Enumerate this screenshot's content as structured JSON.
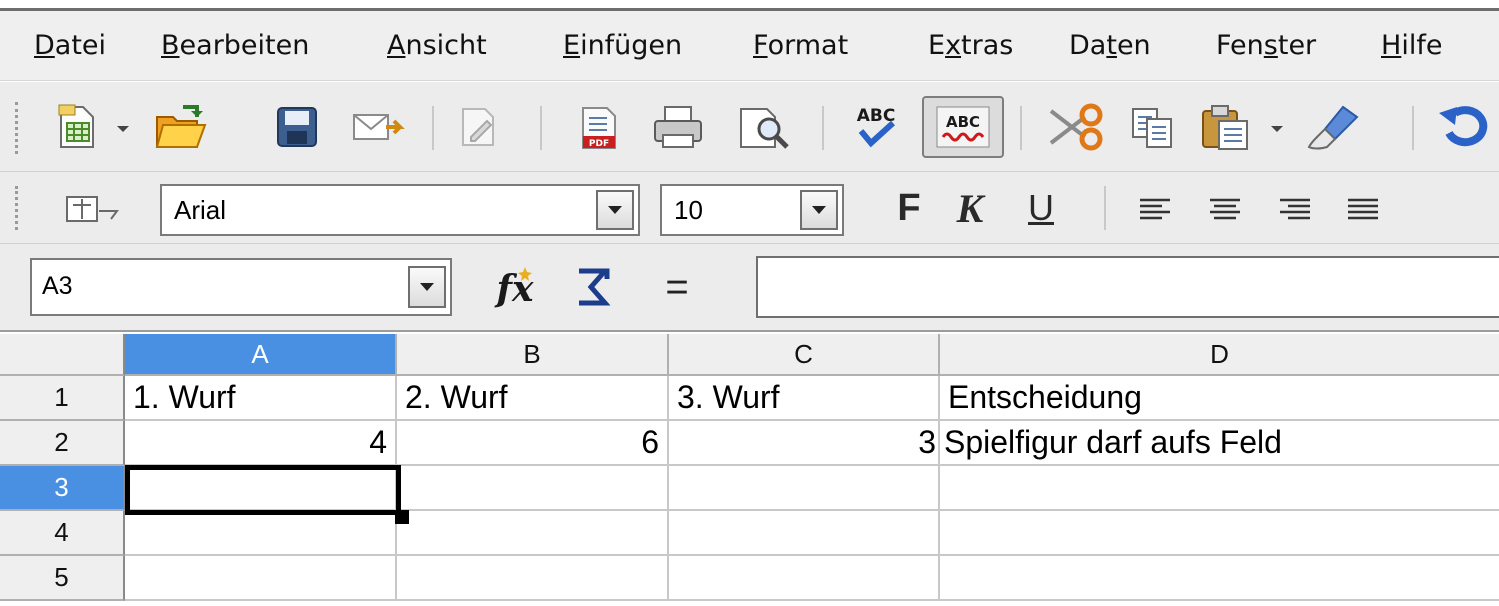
{
  "menu": [
    {
      "label": "Datei",
      "accel": "D"
    },
    {
      "label": "Bearbeiten",
      "accel": "B"
    },
    {
      "label": "Ansicht",
      "accel": "A"
    },
    {
      "label": "Einfügen",
      "accel": "E"
    },
    {
      "label": "Format",
      "accel": "F"
    },
    {
      "label": "Extras",
      "accel": "x"
    },
    {
      "label": "Daten",
      "accel": "t"
    },
    {
      "label": "Fenster",
      "accel": "s"
    },
    {
      "label": "Hilfe",
      "accel": "H"
    }
  ],
  "formatting": {
    "font_name": "Arial",
    "font_size": "10",
    "bold_label": "F",
    "italic_label": "K",
    "underline_label": "U"
  },
  "formula_bar": {
    "name_box": "A3",
    "equals": "=",
    "input": ""
  },
  "sheet": {
    "columns": [
      "A",
      "B",
      "C",
      "D"
    ],
    "selected_column": "A",
    "rows": [
      "1",
      "2",
      "3",
      "4",
      "5"
    ],
    "selected_row": "3",
    "active_cell": "A3",
    "cells": {
      "A1": "1. Wurf",
      "B1": "2. Wurf",
      "C1": "3. Wurf",
      "D1": "Entscheidung",
      "A2": "4",
      "B2": "6",
      "C2": "3",
      "D2": "Spielfigur darf aufs Feld"
    }
  },
  "colors": {
    "selection": "#4a90e2",
    "toolbar_bg": "#ececec"
  },
  "icons": {
    "standard_toolbar": [
      "new-document-icon",
      "open-folder-icon",
      "save-icon",
      "email-icon",
      "edit-file-icon",
      "export-pdf-icon",
      "print-icon",
      "page-preview-icon",
      "spellcheck-icon",
      "auto-spellcheck-icon",
      "cut-icon",
      "copy-icon",
      "paste-icon",
      "format-paintbrush-icon",
      "undo-icon"
    ],
    "formatting_toolbar": [
      "styles-icon",
      "align-left-icon",
      "align-center-icon",
      "align-right-icon",
      "justify-icon"
    ],
    "formula_bar": [
      "function-wizard-icon",
      "sum-icon"
    ]
  }
}
